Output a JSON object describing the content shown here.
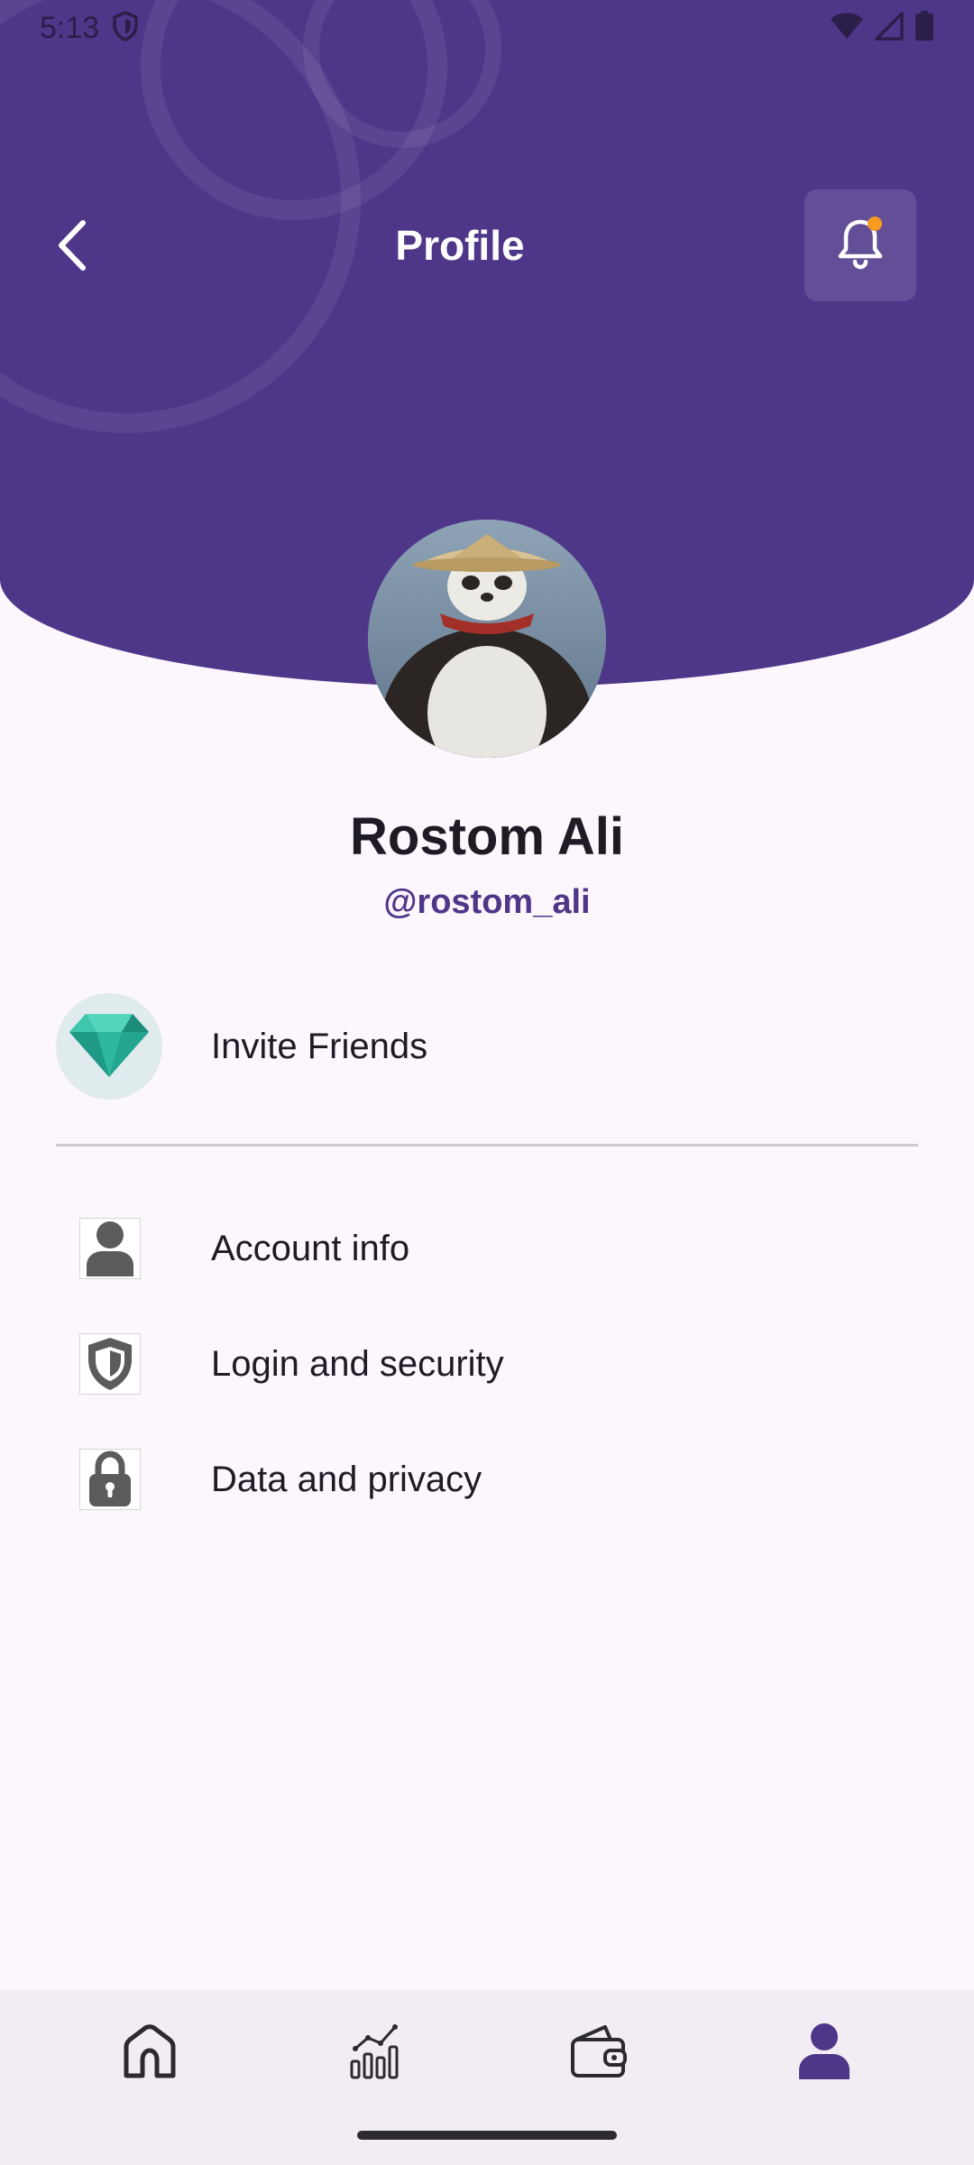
{
  "status_bar": {
    "time": "5:13"
  },
  "header": {
    "title": "Profile"
  },
  "profile": {
    "name": "Rostom Ali",
    "handle": "@rostom_ali"
  },
  "menu": {
    "invite_label": "Invite Friends",
    "items": [
      {
        "label": "Account info",
        "icon": "person-icon"
      },
      {
        "label": "Login and security",
        "icon": "shield-icon"
      },
      {
        "label": "Data and privacy",
        "icon": "lock-icon"
      }
    ]
  },
  "bottom_nav": [
    {
      "name": "home",
      "icon": "home-icon",
      "active": false
    },
    {
      "name": "stats",
      "icon": "chart-icon",
      "active": false
    },
    {
      "name": "wallet",
      "icon": "wallet-icon",
      "active": false
    },
    {
      "name": "profile",
      "icon": "person-icon",
      "active": true
    }
  ],
  "colors": {
    "primary": "#4E3789",
    "background": "#FCF6FD",
    "notification_dot": "#F59A23",
    "invite_icon_bg": "#E0EBEE"
  }
}
